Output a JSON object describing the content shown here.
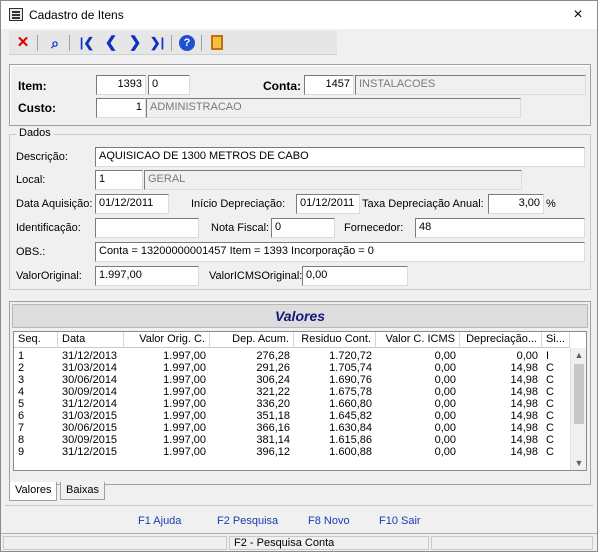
{
  "window": {
    "title": "Cadastro de Itens",
    "close_icon": "×"
  },
  "toolbar": [
    {
      "name": "delete-icon",
      "glyph": "✕",
      "kind": "red"
    },
    {
      "name": "search-icon",
      "glyph": "⌕",
      "kind": "blue"
    },
    {
      "name": "first-record-icon",
      "glyph": "|❮",
      "kind": "blue"
    },
    {
      "name": "prev-record-icon",
      "glyph": "❮",
      "kind": "blue"
    },
    {
      "name": "next-record-icon",
      "glyph": "❯",
      "kind": "blue"
    },
    {
      "name": "last-record-icon",
      "glyph": "❯|",
      "kind": "blue"
    },
    {
      "name": "help-icon",
      "glyph": "?",
      "kind": "help"
    },
    {
      "name": "exit-door-icon",
      "glyph": "",
      "kind": "door"
    }
  ],
  "header": {
    "item_label": "Item:",
    "item_number": "1393",
    "item_sub": "0",
    "conta_label": "Conta:",
    "conta_code": "1457",
    "conta_name": "INSTALACOES",
    "custo_label": "Custo:",
    "custo_code": "1",
    "custo_name": "ADMINISTRACAO"
  },
  "dados": {
    "legend": "Dados",
    "descricao_label": "Descrição:",
    "descricao_value": "AQUISICAO DE 1300 METROS DE CABO",
    "local_label": "Local:",
    "local_code": "1",
    "local_name": "GERAL",
    "data_aquisicao_label": "Data Aquisição:",
    "data_aquisicao_value": "01/12/2011",
    "inicio_depreciacao_label": "Início Depreciação:",
    "inicio_depreciacao_value": "01/12/2011",
    "taxa_label": "Taxa Depreciação Anual:",
    "taxa_value": "3,00",
    "taxa_unit": "%",
    "identificacao_label": "Identificação:",
    "identificacao_value": "",
    "nota_fiscal_label": "Nota Fiscal:",
    "nota_fiscal_value": "0",
    "fornecedor_label": "Fornecedor:",
    "fornecedor_value": "48",
    "obs_label": "OBS.:",
    "obs_value": "Conta = 13200000001457 Item = 1393 Incorporação = 0",
    "valor_original_label": "ValorOriginal:",
    "valor_original_value": "1.997,00",
    "valor_icms_label": "ValorICMSOriginal:",
    "valor_icms_value": "0,00"
  },
  "valores": {
    "title": "Valores",
    "columns": [
      "Seq.",
      "Data",
      "Valor Orig. C.",
      "Dep. Acum.",
      "Residuo Cont.",
      "Valor C. ICMS",
      "Depreciação...",
      "Si..."
    ],
    "rows": [
      [
        "1",
        "31/12/2013",
        "1.997,00",
        "276,28",
        "1.720,72",
        "0,00",
        "0,00",
        "I"
      ],
      [
        "2",
        "31/03/2014",
        "1.997,00",
        "291,26",
        "1.705,74",
        "0,00",
        "14,98",
        "C"
      ],
      [
        "3",
        "30/06/2014",
        "1.997,00",
        "306,24",
        "1.690,76",
        "0,00",
        "14,98",
        "C"
      ],
      [
        "4",
        "30/09/2014",
        "1.997,00",
        "321,22",
        "1.675,78",
        "0,00",
        "14,98",
        "C"
      ],
      [
        "5",
        "31/12/2014",
        "1.997,00",
        "336,20",
        "1.660,80",
        "0,00",
        "14,98",
        "C"
      ],
      [
        "6",
        "31/03/2015",
        "1.997,00",
        "351,18",
        "1.645,82",
        "0,00",
        "14,98",
        "C"
      ],
      [
        "7",
        "30/06/2015",
        "1.997,00",
        "366,16",
        "1.630,84",
        "0,00",
        "14,98",
        "C"
      ],
      [
        "8",
        "30/09/2015",
        "1.997,00",
        "381,14",
        "1.615,86",
        "0,00",
        "14,98",
        "C"
      ],
      [
        "9",
        "31/12/2015",
        "1.997,00",
        "396,12",
        "1.600,88",
        "0,00",
        "14,98",
        "C"
      ]
    ]
  },
  "tabs": [
    "Valores",
    "Baixas"
  ],
  "function_keys": [
    "F1 Ajuda",
    "F2 Pesquisa",
    "F8 Novo",
    "F10 Sair"
  ],
  "status": {
    "message": "F2 - Pesquisa Conta"
  }
}
